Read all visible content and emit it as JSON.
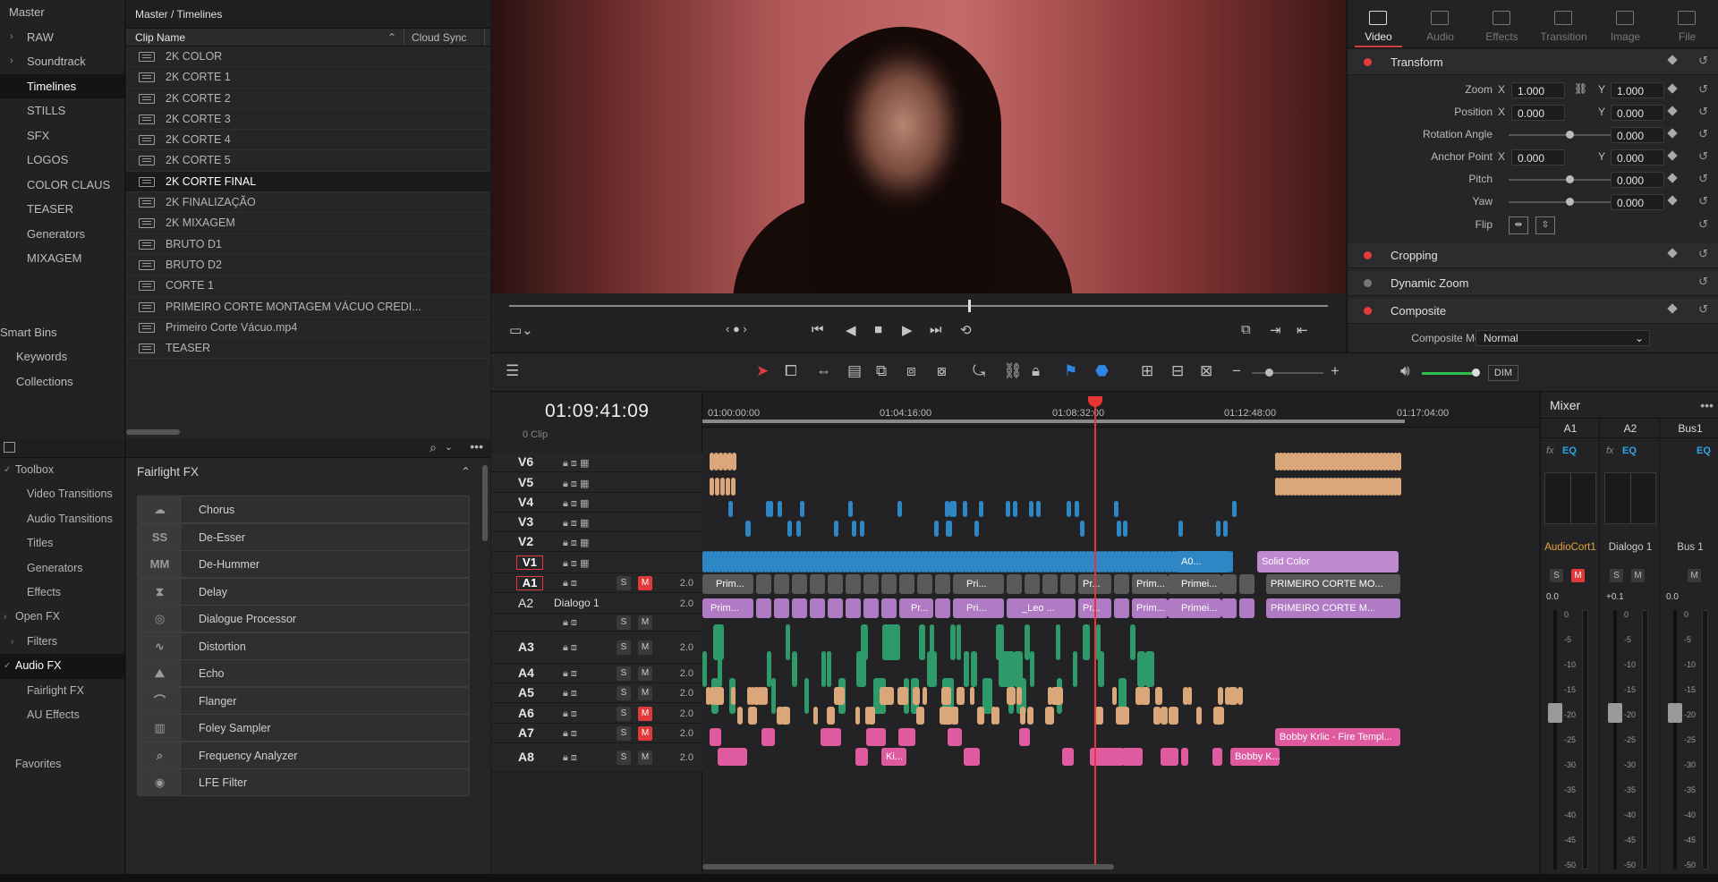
{
  "bins": {
    "master": "Master",
    "items": [
      {
        "label": "RAW",
        "chev": true
      },
      {
        "label": "Soundtrack",
        "chev": true
      },
      {
        "label": "Timelines",
        "active": true
      },
      {
        "label": "STILLS"
      },
      {
        "label": "SFX"
      },
      {
        "label": "LOGOS"
      },
      {
        "label": "COLOR CLAUS"
      },
      {
        "label": "TEASER"
      },
      {
        "label": "Generators"
      },
      {
        "label": "MIXAGEM"
      }
    ],
    "smart_bins": "Smart Bins",
    "smart_items": [
      "Keywords",
      "Collections"
    ]
  },
  "clips": {
    "path": "Master / Timelines",
    "col_name": "Clip Name",
    "col_cloud": "Cloud Sync",
    "rows": [
      "2K COLOR",
      "2K CORTE 1",
      "2K CORTE 2",
      "2K CORTE 3",
      "2K CORTE 4",
      "2K CORTE 5",
      "2K CORTE FINAL",
      "2K FINALIZAÇÃO",
      "2K MIXAGEM",
      "BRUTO D1",
      "BRUTO D2",
      "CORTE 1",
      "PRIMEIRO CORTE MONTAGEM VÁCUO CREDI...",
      "Primeiro Corte Vácuo.mp4",
      "TEASER"
    ],
    "selected_index": 6
  },
  "fx_tree": [
    {
      "label": "Toolbox",
      "level": 0,
      "chev": "open"
    },
    {
      "label": "Video Transitions",
      "level": 1
    },
    {
      "label": "Audio Transitions",
      "level": 1
    },
    {
      "label": "Titles",
      "level": 1
    },
    {
      "label": "Generators",
      "level": 1
    },
    {
      "label": "Effects",
      "level": 1
    },
    {
      "label": "Open FX",
      "level": 0,
      "chev": "closed"
    },
    {
      "label": "Filters",
      "level": 1,
      "chev": "closed"
    },
    {
      "label": "Audio FX",
      "level": 0,
      "chev": "open",
      "active": true
    },
    {
      "label": "Fairlight FX",
      "level": 1
    },
    {
      "label": "AU Effects",
      "level": 1
    },
    {
      "label": "",
      "level": 1
    },
    {
      "label": "Favorites",
      "level": 0
    }
  ],
  "fx_list": {
    "title": "Fairlight FX",
    "items": [
      {
        "name": "Chorus",
        "icon": "☁"
      },
      {
        "name": "De-Esser",
        "icon": "SS"
      },
      {
        "name": "De-Hummer",
        "icon": "MM"
      },
      {
        "name": "Delay",
        "icon": "⧗"
      },
      {
        "name": "Dialogue Processor",
        "icon": "◎"
      },
      {
        "name": "Distortion",
        "icon": "∿"
      },
      {
        "name": "Echo",
        "icon": "⛰"
      },
      {
        "name": "Flanger",
        "icon": "⌒"
      },
      {
        "name": "Foley Sampler",
        "icon": "▥"
      },
      {
        "name": "Frequency Analyzer",
        "icon": "⌕"
      },
      {
        "name": "LFE Filter",
        "icon": "◉"
      }
    ]
  },
  "inspector": {
    "tabs": [
      "Video",
      "Audio",
      "Effects",
      "Transition",
      "Image",
      "File"
    ],
    "active_tab": "Video",
    "transform_title": "Transform",
    "zoom_label": "Zoom",
    "zoom_x": "1.000",
    "zoom_y": "1.000",
    "position_label": "Position",
    "position_x": "0.000",
    "position_y": "0.000",
    "rotation_label": "Rotation Angle",
    "rotation": "0.000",
    "anchor_label": "Anchor Point",
    "anchor_x": "0.000",
    "anchor_y": "0.000",
    "pitch_label": "Pitch",
    "pitch": "0.000",
    "yaw_label": "Yaw",
    "yaw": "0.000",
    "flip_label": "Flip",
    "x_label": "X",
    "y_label": "Y",
    "cropping_title": "Cropping",
    "dynamic_zoom_title": "Dynamic Zoom",
    "composite_title": "Composite",
    "composite_mode_label": "Composite Mode",
    "composite_mode": "Normal"
  },
  "timeline": {
    "timecode": "01:09:41:09",
    "clip_count": "0 Clip",
    "ruler": [
      "01:00:00:00",
      "01:04:16:00",
      "01:08:32:00",
      "01:12:48:00",
      "01:17:04:00"
    ],
    "tracks": [
      {
        "name": "V6",
        "type": "video"
      },
      {
        "name": "V5",
        "type": "video"
      },
      {
        "name": "V4",
        "type": "video"
      },
      {
        "name": "V3",
        "type": "video"
      },
      {
        "name": "V2",
        "type": "video"
      },
      {
        "name": "V1",
        "type": "video",
        "boxed": true
      },
      {
        "name": "A1",
        "type": "audio",
        "boxed": true,
        "mute": true,
        "vol": "2.0"
      },
      {
        "name": "A2",
        "type": "audio",
        "label": "Dialogo 1",
        "vol": "2.0"
      },
      {
        "name": "",
        "type": "audio"
      },
      {
        "name": "A3",
        "type": "audio",
        "vol": "2.0"
      },
      {
        "name": "A4",
        "type": "audio",
        "vol": "2.0"
      },
      {
        "name": "A5",
        "type": "audio",
        "vol": "2.0"
      },
      {
        "name": "A6",
        "type": "audio",
        "mute": true,
        "vol": "2.0"
      },
      {
        "name": "A7",
        "type": "audio",
        "mute": true,
        "vol": "2.0"
      },
      {
        "name": "A8",
        "type": "audio",
        "vol": "2.0"
      }
    ],
    "clip_labels": {
      "v2_a": "A0...",
      "solid_color": "Solid Color",
      "v1_a": "Prim...",
      "v1_b": "Pri...",
      "v1_c": "Pr...",
      "v1_d": "Prim...",
      "v1_e": "Primei...",
      "v1_link": "PRIMEIRO CORTE MO...",
      "a1_a": "Prim...",
      "a1_b": "Pr...",
      "a1_c": "Pri...",
      "a1_d": "_Leo ...",
      "a1_e": "Pr...",
      "a1_f": "Prim...",
      "a1_g": "Primei...",
      "a1_link": "PRIMEIRO CORTE M...",
      "a6_clip": "Bobby Krlic - Fire Templ...",
      "a7_a": "Ki...",
      "a7_b": "Bobby K..."
    }
  },
  "mixer": {
    "title": "Mixer",
    "channels": [
      {
        "id": "A1",
        "name": "AudioCort1",
        "accent": true,
        "level": "0.0",
        "mute": true
      },
      {
        "id": "A2",
        "name": "Dialogo 1",
        "level": "+0.1",
        "mute": false
      },
      {
        "id": "Bus1",
        "name": "Bus 1",
        "level": "0.0",
        "mute": false
      }
    ],
    "fx": "fx",
    "eq": "EQ",
    "solo": "S",
    "mute": "M",
    "scale": [
      "0",
      "-5",
      "-10",
      "-15",
      "-20",
      "-25",
      "-30",
      "-35",
      "-40",
      "-45",
      "-50"
    ]
  },
  "toolbar": {
    "dim_label": "DIM"
  },
  "colors": {
    "accent": "#e23b3b",
    "video_clip": "#2f86c5",
    "audio_clip": "#b07ac5",
    "dialog": "#2e9a69",
    "music": "#d9a77a",
    "sfx": "#e05aa0",
    "solid": "#c08ad0"
  }
}
